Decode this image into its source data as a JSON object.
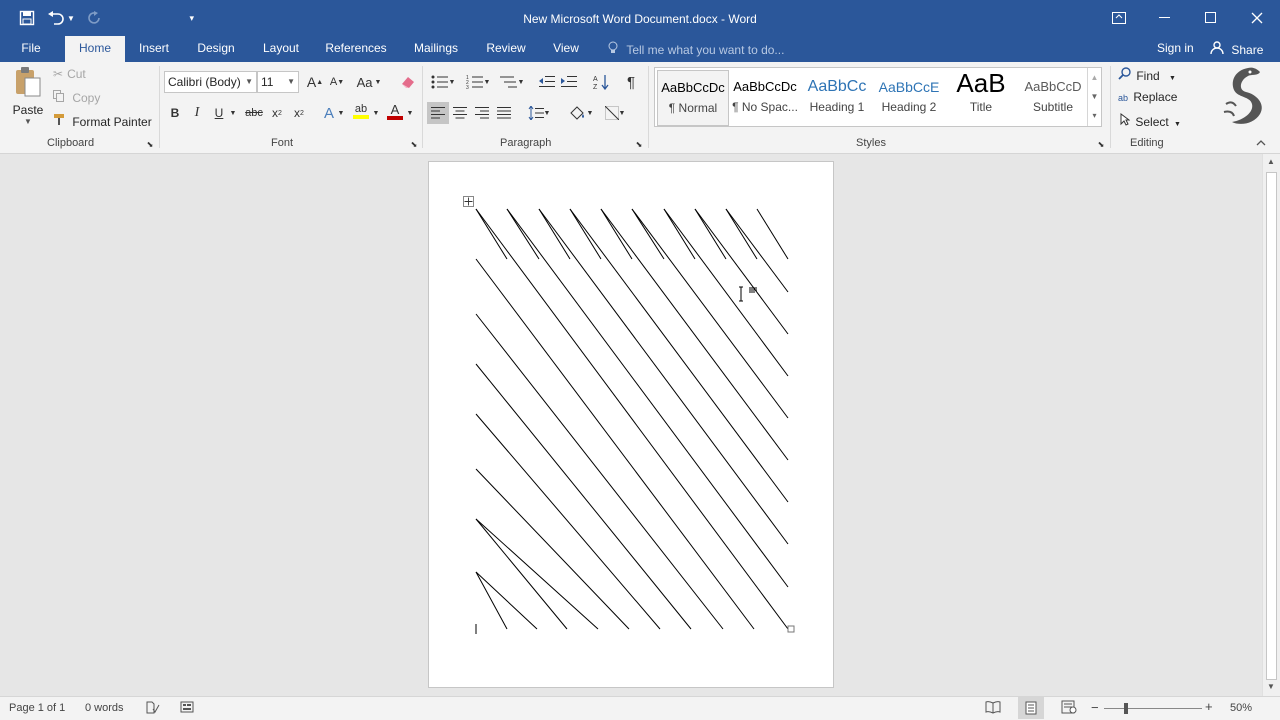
{
  "window": {
    "title": "New Microsoft Word Document.docx - Word"
  },
  "qat": {
    "save_icon": "save-icon",
    "undo_icon": "undo-icon",
    "redo_icon": "redo-icon",
    "customize_icon": "customize-qat-icon"
  },
  "tabs": {
    "file": "File",
    "home": "Home",
    "insert": "Insert",
    "design": "Design",
    "layout": "Layout",
    "references": "References",
    "mailings": "Mailings",
    "review": "Review",
    "view": "View"
  },
  "tellme": {
    "placeholder": "Tell me what you want to do..."
  },
  "account": {
    "signin": "Sign in",
    "share": "Share"
  },
  "clipboard": {
    "paste": "Paste",
    "cut": "Cut",
    "copy": "Copy",
    "format_painter": "Format Painter",
    "group_label": "Clipboard"
  },
  "font": {
    "family": "Calibri (Body)",
    "size": "11",
    "grow": "A",
    "shrink": "A",
    "change_case": "Aa",
    "bold": "B",
    "italic": "I",
    "underline": "U",
    "strikethrough": "abc",
    "subscript": "x",
    "superscript": "x",
    "effects": "A",
    "highlight": "ab",
    "color": "A",
    "group_label": "Font"
  },
  "paragraph": {
    "show_marks": "¶",
    "group_label": "Paragraph"
  },
  "styles": {
    "items": [
      {
        "sample": "AaBbCcDc",
        "name": "¶ Normal"
      },
      {
        "sample": "AaBbCcDc",
        "name": "¶ No Spac..."
      },
      {
        "sample": "AaBbCc",
        "name": "Heading 1"
      },
      {
        "sample": "AaBbCcE",
        "name": "Heading 2"
      },
      {
        "sample": "AaB",
        "name": "Title"
      },
      {
        "sample": "AaBbCcD",
        "name": "Subtitle"
      }
    ],
    "group_label": "Styles"
  },
  "editing": {
    "find": "Find",
    "replace": "Replace",
    "select": "Select",
    "group_label": "Editing"
  },
  "status": {
    "page": "Page 1 of 1",
    "words": "0 words",
    "zoom": "50%",
    "zoom_level": 0.5
  },
  "colors": {
    "brand": "#2b579a",
    "ribbon": "#f3f3f3",
    "canvas": "#e6e6e6",
    "highlight": "#ffff00",
    "font_color": "#c00000"
  }
}
